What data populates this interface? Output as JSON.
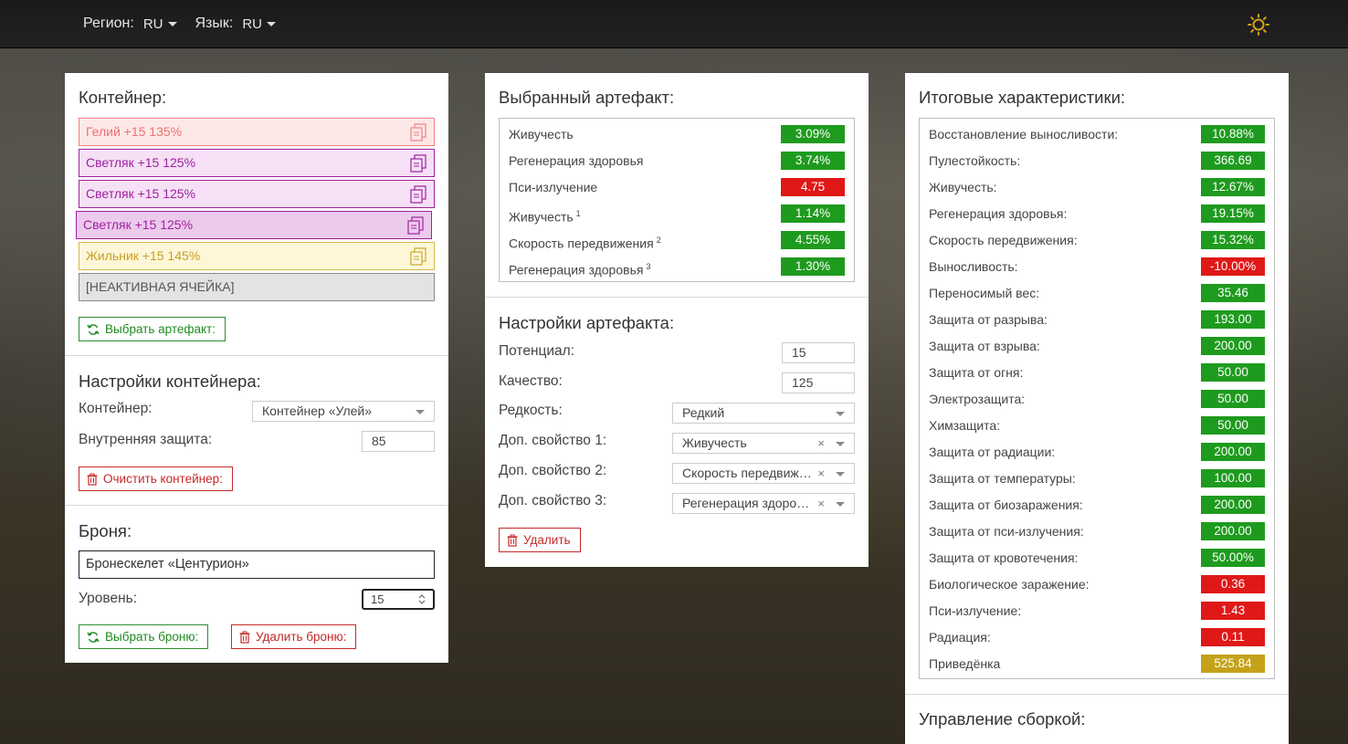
{
  "topbar": {
    "region_label": "Регион:",
    "region_value": "RU",
    "language_label": "Язык:",
    "language_value": "RU"
  },
  "container": {
    "title": "Контейнер:",
    "slots": [
      {
        "label": "Гелий +15 135%",
        "color": "#f08080"
      },
      {
        "label": "Светляк +15 125%",
        "color": "#a020a0"
      },
      {
        "label": "Светляк +15 125%",
        "color": "#a020a0"
      },
      {
        "label": "Светляк +15 125%",
        "color": "#a020a0"
      },
      {
        "label": "Жильник +15 145%",
        "color": "#c8a830"
      },
      {
        "label": "[НЕАКТИВНАЯ ЯЧЕЙКА]",
        "color": "#8a8a8a"
      }
    ],
    "choose_artifact_button": "Выбрать артефакт:"
  },
  "container_settings": {
    "title": "Настройки контейнера:",
    "container_label": "Контейнер:",
    "container_value": "Контейнер «Улей»",
    "protection_label": "Внутренняя защита:",
    "protection_value": "85",
    "clear_button": "Очистить контейнер:"
  },
  "armor": {
    "title": "Броня:",
    "armor_value": "Бронескелет «Центурион»",
    "level_label": "Уровень:",
    "level_value": "15",
    "choose_button": "Выбрать броню:",
    "delete_button": "Удалить броню:"
  },
  "selected_artifact": {
    "title": "Выбранный артефакт:",
    "stats": [
      {
        "name": "Живучесть",
        "sup": "",
        "value": "3.09%",
        "status": "good"
      },
      {
        "name": "Регенерация здоровья",
        "sup": "",
        "value": "3.74%",
        "status": "good"
      },
      {
        "name": "Пси-излучение",
        "sup": "",
        "value": "4.75",
        "status": "bad"
      },
      {
        "name": "Живучесть",
        "sup": "1",
        "value": "1.14%",
        "status": "good"
      },
      {
        "name": "Скорость передвижения",
        "sup": "2",
        "value": "4.55%",
        "status": "good"
      },
      {
        "name": "Регенерация здоровья",
        "sup": "3",
        "value": "1.30%",
        "status": "good"
      }
    ]
  },
  "artifact_settings": {
    "title": "Настройки артефакта:",
    "potential_label": "Потенциал:",
    "potential_value": "15",
    "quality_label": "Качество:",
    "quality_value": "125",
    "rarity_label": "Редкость:",
    "rarity_value": "Редкий",
    "prop1_label": "Доп. свойство 1:",
    "prop1_value": "Живучесть",
    "prop2_label": "Доп. свойство 2:",
    "prop2_value": "Скорость передвижения",
    "prop3_label": "Доп. свойство 3:",
    "prop3_value": "Регенерация здоровья",
    "clear_symbol": "×",
    "delete_button": "Удалить"
  },
  "totals": {
    "title": "Итоговые характеристики:",
    "stats": [
      {
        "name": "Восстановление выносливости:",
        "value": "10.88%",
        "status": "good"
      },
      {
        "name": "Пулестойкость:",
        "value": "366.69",
        "status": "good"
      },
      {
        "name": "Живучесть:",
        "value": "12.67%",
        "status": "good"
      },
      {
        "name": "Регенерация здоровья:",
        "value": "19.15%",
        "status": "good"
      },
      {
        "name": "Скорость передвижения:",
        "value": "15.32%",
        "status": "good"
      },
      {
        "name": "Выносливость:",
        "value": "-10.00%",
        "status": "bad"
      },
      {
        "name": "Переносимый вес:",
        "value": "35.46",
        "status": "good"
      },
      {
        "name": "Защита от разрыва:",
        "value": "193.00",
        "status": "good"
      },
      {
        "name": "Защита от взрыва:",
        "value": "200.00",
        "status": "good"
      },
      {
        "name": "Защита от огня:",
        "value": "50.00",
        "status": "good"
      },
      {
        "name": "Электрозащита:",
        "value": "50.00",
        "status": "good"
      },
      {
        "name": "Химзащита:",
        "value": "50.00",
        "status": "good"
      },
      {
        "name": "Защита от радиации:",
        "value": "200.00",
        "status": "good"
      },
      {
        "name": "Защита от температуры:",
        "value": "100.00",
        "status": "good"
      },
      {
        "name": "Защита от биозаражения:",
        "value": "200.00",
        "status": "good"
      },
      {
        "name": "Защита от пси-излучения:",
        "value": "200.00",
        "status": "good"
      },
      {
        "name": "Защита от кровотечения:",
        "value": "50.00%",
        "status": "good"
      },
      {
        "name": "Биологическое заражение:",
        "value": "0.36",
        "status": "bad"
      },
      {
        "name": "Пси-излучение:",
        "value": "1.43",
        "status": "bad"
      },
      {
        "name": "Радиация:",
        "value": "0.11",
        "status": "bad"
      },
      {
        "name": "Приведёнка",
        "value": "525.84",
        "status": "neutral"
      }
    ]
  },
  "build_management": {
    "title": "Управление сборкой:"
  },
  "colors": {
    "good": "#1e9b1e",
    "bad": "#e01818",
    "neutral": "#c4a21a",
    "sun_icon": "#d4a017"
  }
}
